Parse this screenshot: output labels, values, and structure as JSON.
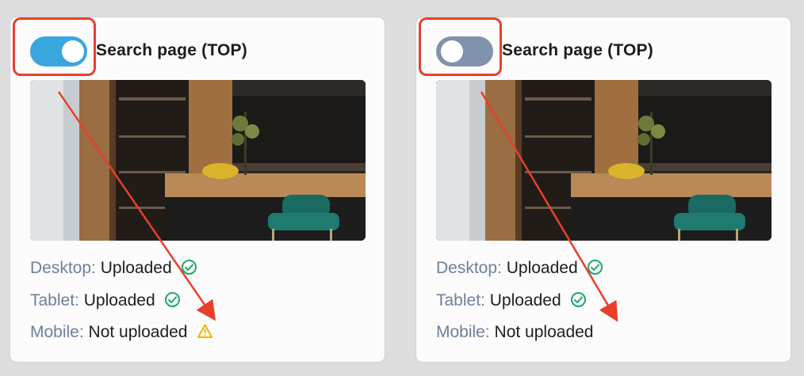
{
  "colors": {
    "toggle_on": "#3aa6de",
    "toggle_off": "#7f93ad",
    "highlight": "#e8402b",
    "success": "#1aa86a",
    "warning": "#f0b400",
    "label": "#6e809b"
  },
  "cards": [
    {
      "toggle_state": "on",
      "title": "Search page (TOP)",
      "image_alt_icon": "kitchen-photo",
      "statuses": [
        {
          "label": "Desktop:",
          "value": "Uploaded",
          "icon": "check-circle-icon"
        },
        {
          "label": "Tablet:",
          "value": "Uploaded",
          "icon": "check-circle-icon"
        },
        {
          "label": "Mobile:",
          "value": "Not uploaded",
          "icon": "warning-triangle-icon"
        }
      ]
    },
    {
      "toggle_state": "off",
      "title": "Search page (TOP)",
      "image_alt_icon": "kitchen-photo",
      "statuses": [
        {
          "label": "Desktop:",
          "value": "Uploaded",
          "icon": "check-circle-icon"
        },
        {
          "label": "Tablet:",
          "value": "Uploaded",
          "icon": "check-circle-icon"
        },
        {
          "label": "Mobile:",
          "value": "Not uploaded",
          "icon": ""
        }
      ]
    }
  ]
}
